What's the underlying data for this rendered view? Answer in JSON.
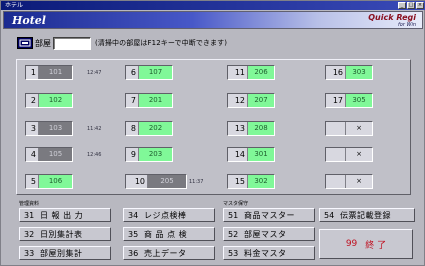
{
  "window": {
    "title": "ホテル"
  },
  "header": {
    "app_title": "Hotel",
    "brand": "Quick Regi",
    "brand_sub": "for Win"
  },
  "search": {
    "label": "部屋",
    "value": "",
    "hint": "(清掃中の部屋はF12キーで中断できます)"
  },
  "rooms": [
    {
      "no": "1",
      "status": "101",
      "state": "occupied",
      "time": "12:47"
    },
    {
      "no": "2",
      "status": "102",
      "state": "vacant",
      "time": ""
    },
    {
      "no": "3",
      "status": "103",
      "state": "occupied",
      "time": "11:42"
    },
    {
      "no": "4",
      "status": "105",
      "state": "occupied",
      "time": "12:46"
    },
    {
      "no": "5",
      "status": "106",
      "state": "vacant",
      "time": ""
    },
    {
      "no": "6",
      "status": "107",
      "state": "vacant",
      "time": ""
    },
    {
      "no": "7",
      "status": "201",
      "state": "vacant",
      "time": ""
    },
    {
      "no": "8",
      "status": "202",
      "state": "vacant",
      "time": ""
    },
    {
      "no": "9",
      "status": "203",
      "state": "vacant",
      "time": ""
    },
    {
      "no": "10",
      "status": "205",
      "state": "occupied",
      "time": "11:37"
    },
    {
      "no": "11",
      "status": "206",
      "state": "vacant",
      "time": ""
    },
    {
      "no": "12",
      "status": "207",
      "state": "vacant",
      "time": ""
    },
    {
      "no": "13",
      "status": "208",
      "state": "vacant",
      "time": ""
    },
    {
      "no": "14",
      "status": "301",
      "state": "vacant",
      "time": ""
    },
    {
      "no": "15",
      "status": "302",
      "state": "vacant",
      "time": ""
    },
    {
      "no": "16",
      "status": "303",
      "state": "vacant",
      "time": ""
    },
    {
      "no": "17",
      "status": "305",
      "state": "vacant",
      "time": ""
    },
    {
      "no": "",
      "status": "×",
      "state": "disabled",
      "time": ""
    },
    {
      "no": "",
      "status": "×",
      "state": "disabled",
      "time": ""
    },
    {
      "no": "",
      "status": "×",
      "state": "disabled",
      "time": ""
    }
  ],
  "sections": {
    "reports": "管理資料",
    "masters": "マスタ保守"
  },
  "menu": [
    {
      "num": "31",
      "label": "日 報 出 力"
    },
    {
      "num": "32",
      "label": "日別集計表"
    },
    {
      "num": "33",
      "label": "部屋別集計"
    },
    {
      "num": "34",
      "label": "レジ点検棒"
    },
    {
      "num": "35",
      "label": "商 品 点 検"
    },
    {
      "num": "36",
      "label": "売上データ"
    },
    {
      "num": "51",
      "label": "商品マスター"
    },
    {
      "num": "52",
      "label": "部屋マスタ"
    },
    {
      "num": "53",
      "label": "料金マスタ"
    },
    {
      "num": "54",
      "label": "伝票記載登録"
    }
  ],
  "exit": {
    "num": "99",
    "label": "終 了"
  },
  "colors": {
    "vacant": "#80f898",
    "occupied": "#7a7a80",
    "exit_text": "#c01020"
  }
}
